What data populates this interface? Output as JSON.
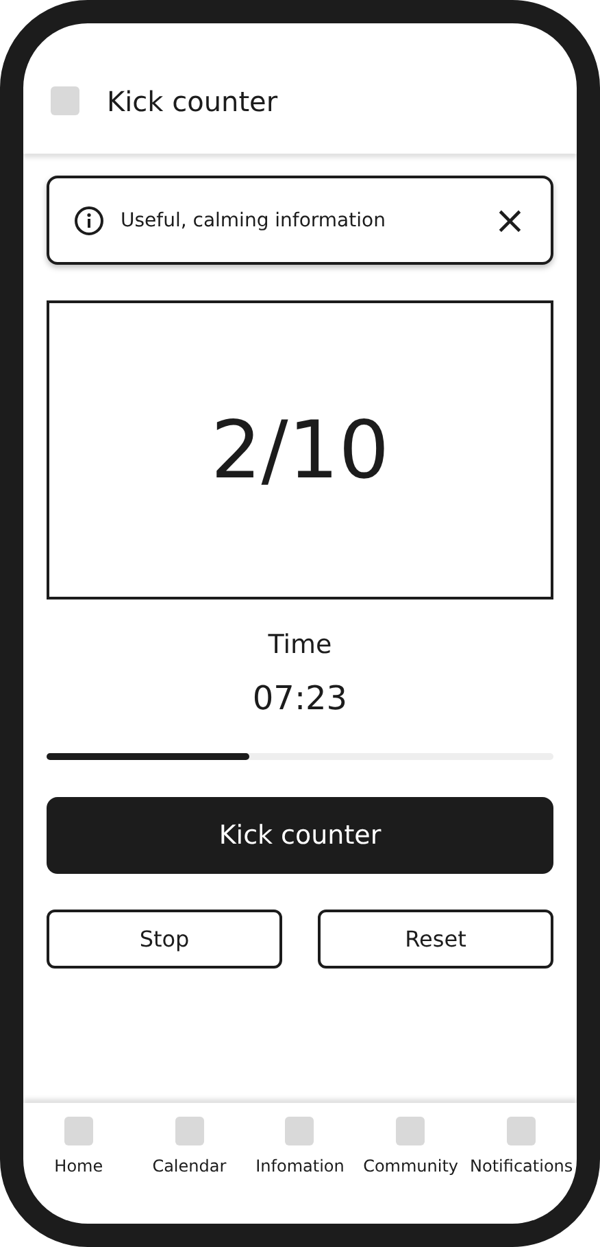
{
  "header": {
    "title": "Kick counter"
  },
  "info_banner": {
    "text": "Useful, calming information",
    "close": "×"
  },
  "counter": {
    "value": "2/10"
  },
  "timer": {
    "label": "Time",
    "value": "07:23",
    "level": 0.4
  },
  "primary_button": "Kick counter",
  "buttons": [
    "Stop",
    "Reset"
  ],
  "nav": [
    {
      "label": "Home"
    },
    {
      "label": "Calendar"
    },
    {
      "label": "Infomation"
    },
    {
      "label": "Community"
    },
    {
      "label": "Notifications"
    }
  ]
}
